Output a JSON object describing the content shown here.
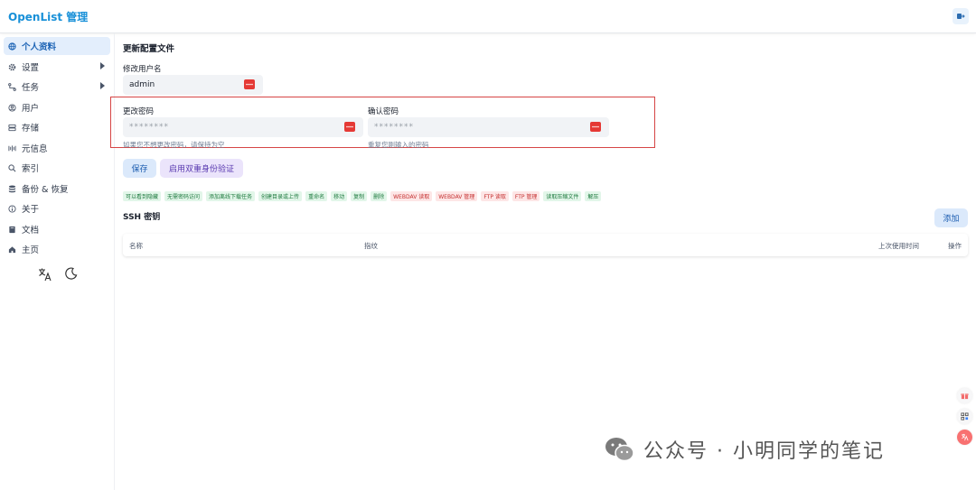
{
  "app": {
    "title": "OpenList 管理"
  },
  "sidebar": {
    "items": [
      {
        "label": "个人资料",
        "icon": "globe-icon",
        "active": true
      },
      {
        "label": "设置",
        "icon": "gear-icon",
        "expandable": true
      },
      {
        "label": "任务",
        "icon": "tasks-icon",
        "expandable": true
      },
      {
        "label": "用户",
        "icon": "user-icon"
      },
      {
        "label": "存储",
        "icon": "storage-icon"
      },
      {
        "label": "元信息",
        "icon": "meta-icon"
      },
      {
        "label": "索引",
        "icon": "search-icon"
      },
      {
        "label": "备份 & 恢复",
        "icon": "database-icon"
      },
      {
        "label": "关于",
        "icon": "info-icon"
      },
      {
        "label": "文档",
        "icon": "book-icon"
      },
      {
        "label": "主页",
        "icon": "home-icon"
      }
    ]
  },
  "profile": {
    "title": "更新配置文件",
    "username_label": "修改用户名",
    "username_value": "admin",
    "password_label": "更改密码",
    "password_placeholder": "********",
    "password_hint": "如果您不想更改密码，请保持为空",
    "confirm_label": "确认密码",
    "confirm_placeholder": "********",
    "confirm_hint": "重复您刚输入的密码",
    "save_label": "保存",
    "twofa_label": "启用双重身份验证"
  },
  "permissions": [
    {
      "label": "可以看到隐藏",
      "granted": true
    },
    {
      "label": "无需密码访问",
      "granted": true
    },
    {
      "label": "添加离线下载任务",
      "granted": true
    },
    {
      "label": "创建目录或上传",
      "granted": true
    },
    {
      "label": "重命名",
      "granted": true
    },
    {
      "label": "移动",
      "granted": true
    },
    {
      "label": "复制",
      "granted": true
    },
    {
      "label": "删除",
      "granted": true
    },
    {
      "label": "WEBDAV 读取",
      "granted": false
    },
    {
      "label": "WEBDAV 管理",
      "granted": false
    },
    {
      "label": "FTP 读取",
      "granted": false
    },
    {
      "label": "FTP 管理",
      "granted": false
    },
    {
      "label": "读取压缩文件",
      "granted": true
    },
    {
      "label": "解压",
      "granted": true
    }
  ],
  "ssh": {
    "title": "SSH 密钥",
    "add_label": "添加",
    "columns": [
      "名称",
      "指纹",
      "上次使用时间",
      "操作"
    ]
  },
  "watermark": {
    "text": "公众号 · 小明同学的笔记"
  },
  "colors": {
    "brand": "#1890d8",
    "highlight": "#d64545",
    "key_icon": "#e53935"
  }
}
